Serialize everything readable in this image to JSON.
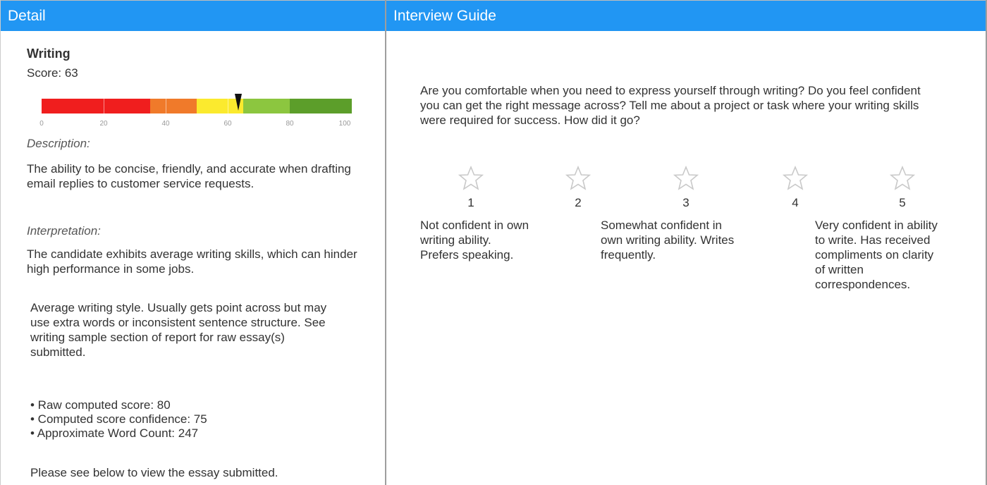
{
  "detail_panel": {
    "header": "Detail",
    "skill_title": "Writing",
    "score_label": "Score: 63",
    "score_value": 63,
    "gauge": {
      "scale_min": 0,
      "scale_max": 100,
      "tick_labels": [
        "0",
        "20",
        "40",
        "60",
        "80",
        "100"
      ],
      "segment_colors": [
        "#f01e1e",
        "#f07a2a",
        "#fbea2e",
        "#8cc63f",
        "#5c9e2a"
      ]
    },
    "description_label": "Description:",
    "description_text": "The ability to be concise, friendly, and accurate when drafting email replies to customer service requests.",
    "interpretation_label": "Interpretation:",
    "interpretation_text": "The candidate exhibits average writing skills, which can hinder high performance in some jobs.",
    "summary_text": "Average writing style. Usually gets point across but may use extra words or inconsistent sentence structure. See writing sample section of report for raw essay(s) submitted.",
    "stats": [
      "• Raw computed score: 80",
      "• Computed score confidence: 75",
      "• Approximate Word Count: 247"
    ],
    "footer_note": "Please see below to view the essay submitted."
  },
  "interview_panel": {
    "header": "Interview Guide",
    "question": "Are you comfortable when you need to express yourself through writing? Do you feel confident you can get the right message across? Tell me about a project or task where your writing skills were required for success. How did it go?",
    "ratings": [
      "1",
      "2",
      "3",
      "4",
      "5"
    ],
    "anchors": {
      "low": "Not confident in own writing ability. Prefers speaking.",
      "mid": "Somewhat confident in own writing ability. Writes frequently.",
      "high": "Very confident in ability to write. Has received compliments on clarity of written correspondences."
    },
    "star_icon": "star-outline-icon",
    "star_color": "#c9c9c9"
  },
  "colors": {
    "header_bg": "#2196f3",
    "header_text": "#ffffff"
  }
}
